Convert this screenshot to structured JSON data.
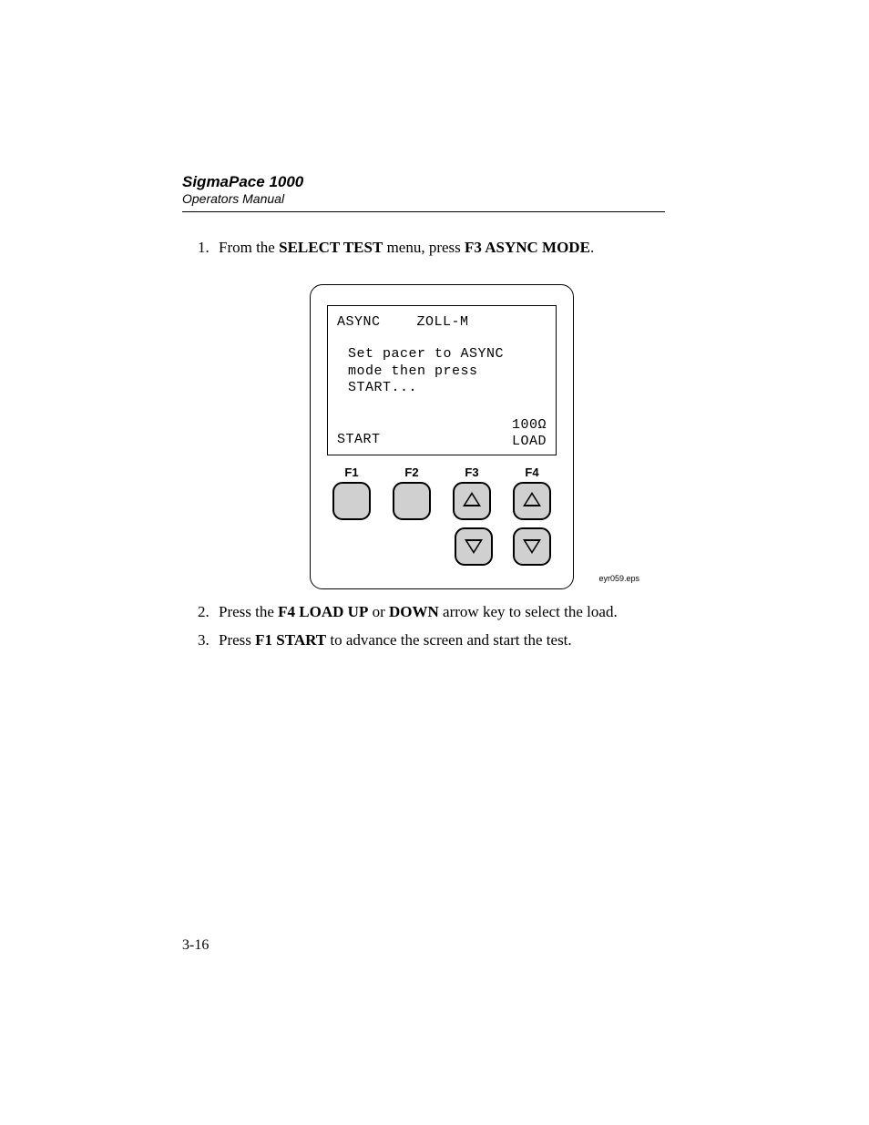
{
  "header": {
    "title": "SigmaPace 1000",
    "subtitle": "Operators Manual"
  },
  "steps": {
    "s1_a": "From the ",
    "s1_b": "SELECT TEST",
    "s1_c": " menu, press ",
    "s1_d": "F3 ASYNC MODE",
    "s1_e": ".",
    "s2_a": "Press the ",
    "s2_b": "F4 LOAD UP",
    "s2_c": " or ",
    "s2_d": "DOWN",
    "s2_e": " arrow key to select the load.",
    "s3_a": "Press ",
    "s3_b": "F1 START",
    "s3_c": " to advance the screen and start the test."
  },
  "lcd": {
    "mode": "ASYNC",
    "device": "ZOLL-M",
    "msg_line1": "Set pacer to ASYNC",
    "msg_line2": "mode then press START...",
    "start_label": "START",
    "load_value": "100Ω",
    "load_label": "LOAD"
  },
  "fkeys": {
    "f1": "F1",
    "f2": "F2",
    "f3": "F3",
    "f4": "F4"
  },
  "figure_caption": "eyr059.eps",
  "page_number": "3-16"
}
